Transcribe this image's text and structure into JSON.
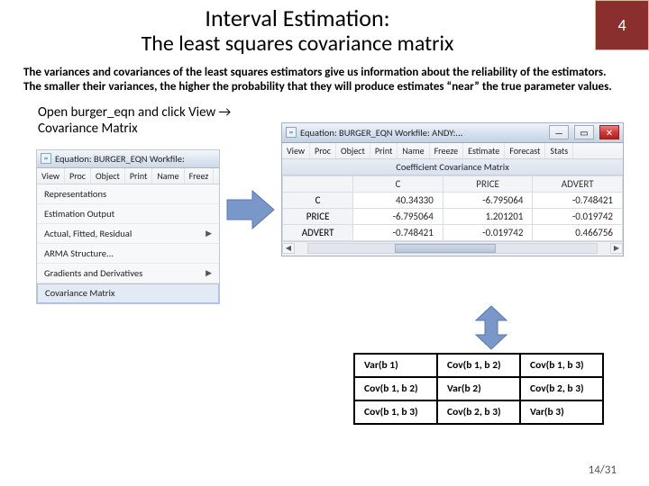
{
  "header": {
    "title": "Interval Estimation:",
    "subtitle": "The least squares covariance matrix",
    "slide_number": "4"
  },
  "body_text": "The variances and covariances of the least squares estimators give us information about the reliability of the estimators. The smaller their variances, the higher the probability that they will produce estimates “near” the true parameter values.",
  "instruction": "Open burger_eqn and click View → Covariance Matrix",
  "win_left": {
    "title": "Equation: BURGER_EQN   Workfile:",
    "toolbar": [
      "View",
      "Proc",
      "Object",
      "Print",
      "Name",
      "Freez"
    ],
    "menu": [
      {
        "label": "Representations",
        "sub": false
      },
      {
        "label": "Estimation Output",
        "sub": false
      },
      {
        "label": "Actual, Fitted, Residual",
        "sub": true
      },
      {
        "label": "ARMA Structure...",
        "sub": false
      },
      {
        "label": "Gradients and Derivatives",
        "sub": true
      },
      {
        "label": "Covariance Matrix",
        "sub": false,
        "selected": true
      }
    ]
  },
  "win_right": {
    "title": "Equation: BURGER_EQN   Workfile: ANDY:...",
    "toolbar": [
      "View",
      "Proc",
      "Object",
      "Print",
      "Name",
      "Freeze",
      "Estimate",
      "Forecast",
      "Stats"
    ],
    "matrix_title": "Coefficient Covariance Matrix"
  },
  "chart_data": {
    "type": "table",
    "title": "Coefficient Covariance Matrix",
    "row_labels": [
      "C",
      "PRICE",
      "ADVERT"
    ],
    "col_labels": [
      "C",
      "PRICE",
      "ADVERT"
    ],
    "values": [
      [
        "40.34330",
        "-6.795064",
        "-0.748421"
      ],
      [
        "-6.795064",
        "1.201201",
        "-0.019742"
      ],
      [
        "-0.748421",
        "-0.019742",
        "0.466756"
      ]
    ]
  },
  "varcov": [
    [
      "Var(b 1)",
      "Cov(b 1, b 2)",
      "Cov(b 1, b 3)"
    ],
    [
      "Cov(b 1, b 2)",
      "Var(b 2)",
      "Cov(b 2, b 3)"
    ],
    [
      "Cov(b 1, b 3)",
      "Cov(b 2, b 3)",
      "Var(b 3)"
    ]
  ],
  "page": "14/31"
}
